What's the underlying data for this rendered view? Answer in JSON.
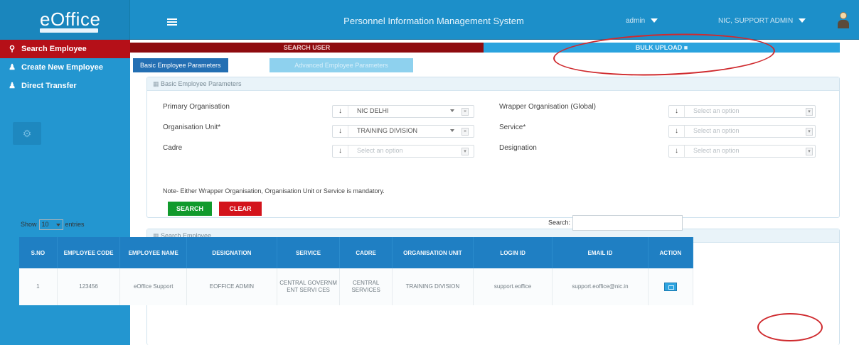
{
  "header": {
    "logo": "eOffice",
    "app_title": "Personnel Information Management System",
    "user_select": "admin",
    "org_select": "NIC, SUPPORT ADMIN",
    "colors": {
      "bar": "#1c8fc9",
      "sidebar": "#2396d0",
      "active": "#b51018"
    }
  },
  "sidebar": {
    "items": [
      {
        "label": "Search Employee",
        "icon": "search-icon"
      },
      {
        "label": "Create New Employee",
        "icon": "user-icon"
      },
      {
        "label": "Direct Transfer",
        "icon": "user-icon"
      }
    ],
    "gear_icon": "gear-icon"
  },
  "tabs": {
    "search_user": "SEARCH USER",
    "bulk_upload": "BULK UPLOAD"
  },
  "param_tabs": {
    "basic": "Basic Employee Parameters",
    "advanced": "Advanced Employee Parameters"
  },
  "basic_panel": {
    "title": "Basic Employee Parameters",
    "fields": [
      {
        "label": "Primary Organisation",
        "value": "NIC DELHI",
        "placeholder": ""
      },
      {
        "label": "Organisation Unit*",
        "value": "TRAINING DIVISION",
        "placeholder": ""
      },
      {
        "label": "Cadre",
        "value": "",
        "placeholder": "Select an option"
      },
      {
        "label": "Wrapper Organisation (Global)",
        "value": "",
        "placeholder": "Select an option"
      },
      {
        "label": "Service*",
        "value": "",
        "placeholder": "Select an option"
      },
      {
        "label": "Designation",
        "value": "",
        "placeholder": "Select an option"
      }
    ],
    "note": "Note- Either Wrapper Organisation, Organisation Unit or Service is mandatory.",
    "search_button": "SEARCH",
    "clear_button": "CLEAR"
  },
  "results_panel": {
    "title": "Search Employee",
    "show_prefix": "Show",
    "show_value": "10",
    "show_suffix": "entries",
    "search_label": "Search:",
    "columns": [
      "S.NO",
      "EMPLOYEE CODE",
      "EMPLOYEE NAME",
      "DESIGNATION",
      "SERVICE",
      "CADRE",
      "ORGANISATION UNIT",
      "LOGIN ID",
      "EMAIL ID",
      "ACTION"
    ],
    "rows": [
      {
        "sno": "1",
        "code": "123456",
        "name": "eOffice Support",
        "designation": "EOFFICE ADMIN",
        "service": "CENTRAL GOVERNM ENT SERVI CES",
        "cadre": "CENTRAL SERVICES",
        "org_unit": "TRAINING DIVISION",
        "login": "support.eoffice",
        "email": "support.eoffice@nic.in"
      }
    ]
  }
}
